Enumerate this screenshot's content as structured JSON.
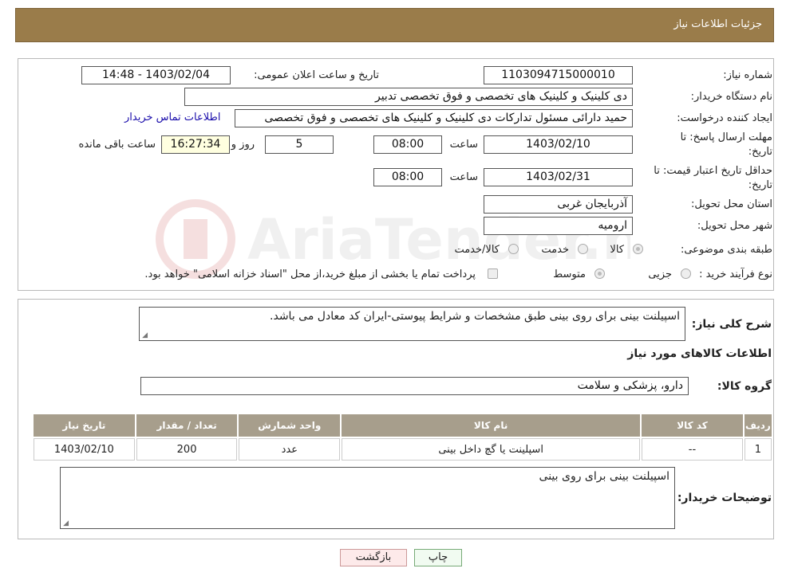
{
  "header": {
    "title": "جزئیات اطلاعات نیاز"
  },
  "form": {
    "need_number_label": "شماره نیاز:",
    "need_number": "1103094715000010",
    "announce_label": "تاریخ و ساعت اعلان عمومی:",
    "announce_value": "1403/02/04 - 14:48",
    "buyer_label": "نام دستگاه خریدار:",
    "buyer_value": "دی کلینیک و کلینیک های تخصصی و فوق تخصصی تدبیر",
    "creator_label": "ایجاد کننده درخواست:",
    "creator_value": "حمید دارائی مسئول تدارکات دی کلینیک و کلینیک های تخصصی و فوق تخصصی",
    "contact_link": "اطلاعات تماس خریدار",
    "deadline_label_1": "مهلت ارسال پاسخ: تا",
    "deadline_label_2": "تاریخ:",
    "deadline_date": "1403/02/10",
    "time_label": "ساعت",
    "deadline_time": "08:00",
    "days_value": "5",
    "days_label": "روز و",
    "remaining_time": "16:27:34",
    "remaining_label": "ساعت باقی مانده",
    "validity_label_1": "حداقل تاریخ اعتبار قیمت: تا",
    "validity_label_2": "تاریخ:",
    "validity_date": "1403/02/31",
    "validity_time": "08:00",
    "province_label": "استان محل تحویل:",
    "province_value": "آذربایجان غربی",
    "city_label": "شهر محل تحویل:",
    "city_value": "ارومیه",
    "category_label": "طبقه بندی موضوعی:",
    "category_options": [
      "کالا",
      "خدمت",
      "کالا/خدمت"
    ],
    "process_label": "نوع فرآیند خرید :",
    "process_options": [
      "جزیی",
      "متوسط"
    ],
    "process_note": "پرداخت تمام یا بخشی از مبلغ خرید،از محل \"اسناد خزانه اسلامی\" خواهد بود."
  },
  "details": {
    "summary_label": "شرح کلی نیاز:",
    "summary_value": "اسپیلنت بینی برای روی بینی طبق مشخصات و شرایط پیوستی-ایران کد معادل می باشد.",
    "goods_info_title": "اطلاعات کالاهای مورد نیاز",
    "goods_group_label": "گروه کالا:",
    "goods_group_value": "دارو، پزشکی و سلامت",
    "table": {
      "headers": [
        "ردیف",
        "کد کالا",
        "نام کالا",
        "واحد شمارش",
        "تعداد / مقدار",
        "تاریخ نیاز"
      ],
      "rows": [
        [
          "1",
          "--",
          "اسپلینت یا گچ داخل بینی",
          "عدد",
          "200",
          "1403/02/10"
        ]
      ]
    },
    "buyer_notes_label": "توضیحات خریدار:",
    "buyer_notes_value": "اسپیلنت بینی برای روی بینی"
  },
  "buttons": {
    "print": "چاپ",
    "back": "بازگشت"
  },
  "watermark_text": "AriaTender.neT",
  "colors": {
    "header_bg": "#9a7c4a",
    "table_header_bg": "#a79e8c",
    "link": "#1a0dab"
  }
}
